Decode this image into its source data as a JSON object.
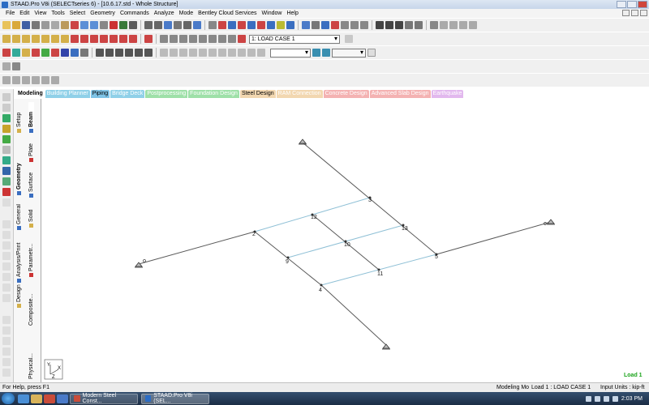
{
  "window": {
    "title": "STAAD.Pro V8i (SELECTseries 6) - [10.6.17.std - Whole Structure]"
  },
  "menu": [
    "File",
    "Edit",
    "View",
    "Tools",
    "Select",
    "Geometry",
    "Commands",
    "Analyze",
    "Mode",
    "Bentley Cloud Services",
    "Window",
    "Help"
  ],
  "toolbar": {
    "load_case": "1: LOAD CASE 1"
  },
  "page_tabs": [
    {
      "label": "Modeling",
      "color": "#ffffff"
    },
    {
      "label": "Building Planner",
      "color": "#8fd0e8"
    },
    {
      "label": "Piping",
      "color": "#7fc3e6"
    },
    {
      "label": "Bridge Deck",
      "color": "#8fd0e8"
    },
    {
      "label": "Postprocessing",
      "color": "#9ee0a8"
    },
    {
      "label": "Foundation Design",
      "color": "#9ee0a8"
    },
    {
      "label": "Steel Design",
      "color": "#f2d7b0"
    },
    {
      "label": "RAM Connection",
      "color": "#f2d7b0"
    },
    {
      "label": "Concrete Design",
      "color": "#f4b2b2"
    },
    {
      "label": "Advanced Slab Design",
      "color": "#f4b2b2"
    },
    {
      "label": "Earthquake",
      "color": "#e2b8ee"
    }
  ],
  "side_tabs": {
    "outer": [
      "Setup",
      "Geometry",
      "General",
      "Analysis/Print",
      "Design"
    ],
    "inner": [
      "Beam",
      "Plate",
      "Surface",
      "Solid",
      "Parametr...",
      "Composite...",
      "Physical..."
    ]
  },
  "model": {
    "node_labels": [
      "2",
      "3",
      "4",
      "5",
      "9",
      "10",
      "11",
      "12",
      "13"
    ],
    "support_count": 4
  },
  "viewport": {
    "load_label": "Load 1",
    "axis": [
      "Y",
      "X",
      "Z"
    ]
  },
  "status": {
    "help": "For Help, press F1",
    "mode": "Modeling Mo",
    "load": "Load 1 : LOAD CASE 1",
    "units": "Input Units : kip-ft"
  },
  "taskbar": {
    "windows": [
      "Modern Steel Const...",
      "STAAD.Pro V8i (SEL..."
    ],
    "time": "2:03 PM"
  },
  "colors": {
    "member": "#5a5a5a",
    "plate_grid": "#8fc0d6",
    "node_label": "#1a1a1a",
    "load_label": "#1aa31a"
  }
}
